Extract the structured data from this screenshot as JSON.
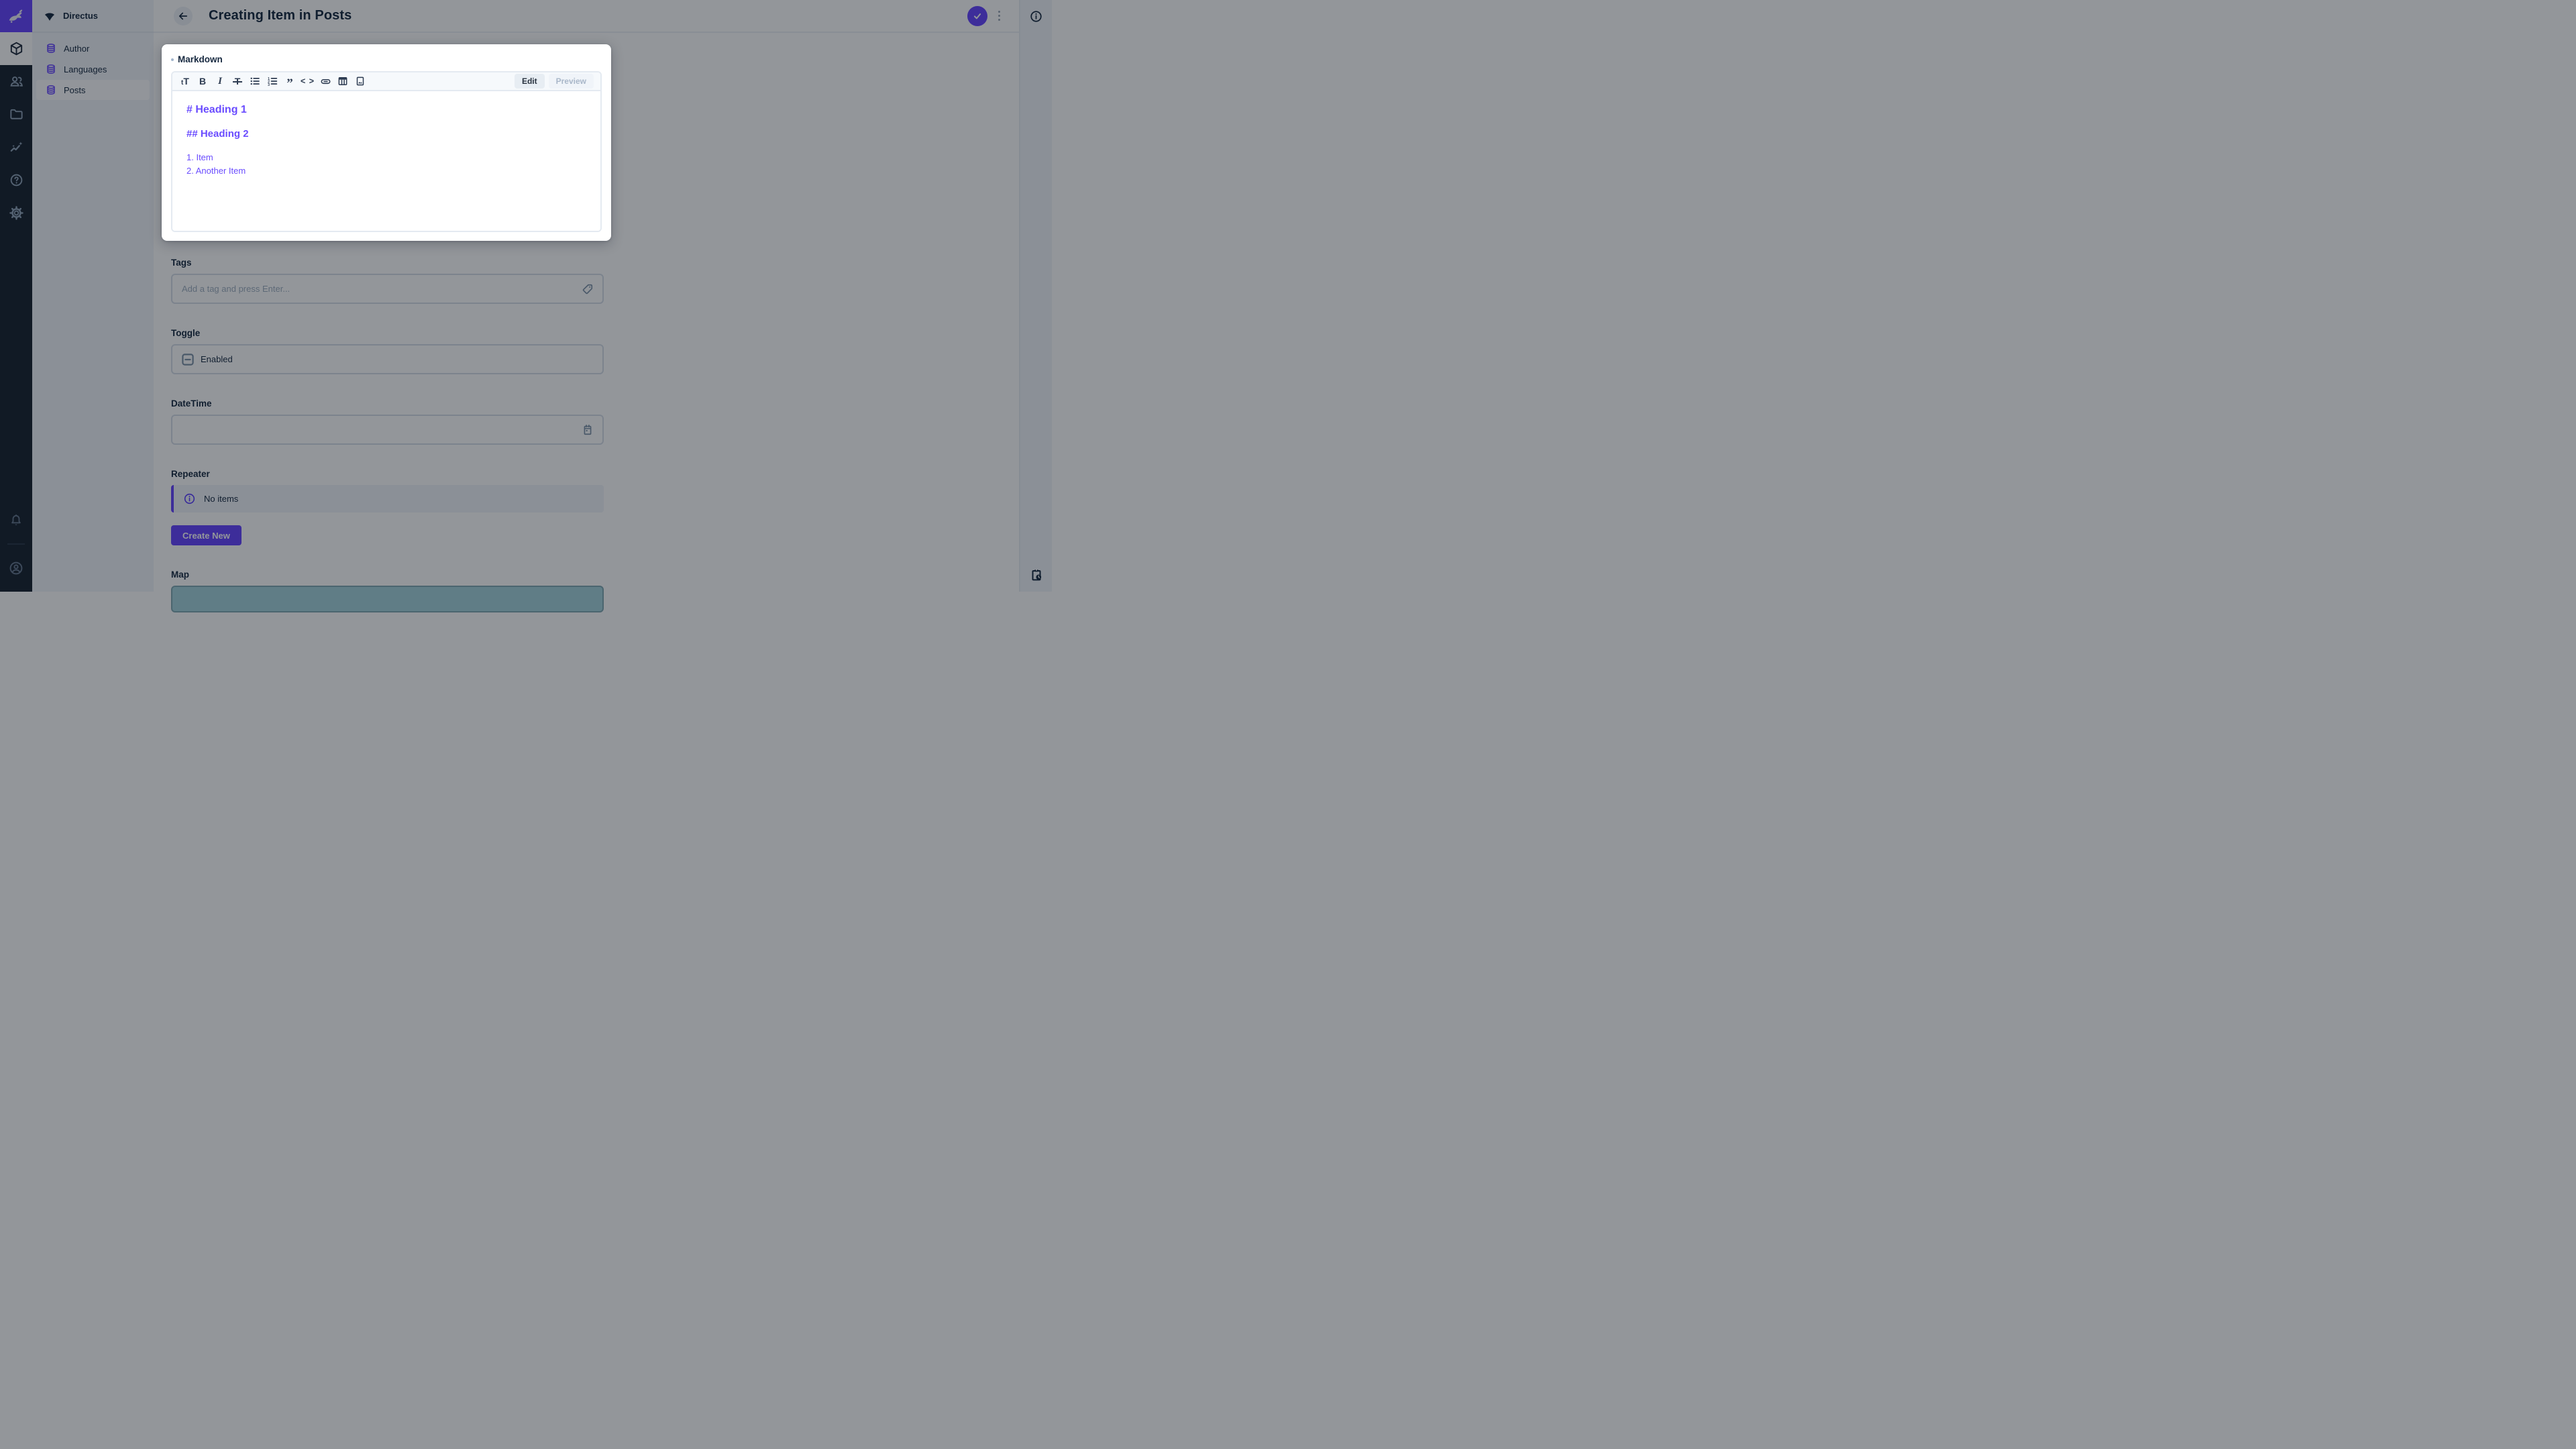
{
  "colors": {
    "accent": "#6644FF",
    "module_bar_bg": "#18222F",
    "sidebar_bg": "#F0F4F9",
    "text_dark": "#172940",
    "muted_icon": "#8FA2B8",
    "markdown_text": "#6A4CFF",
    "map_fill": "#A5D3DC"
  },
  "module_bar": {
    "logo_icon": "directus-rabbit-logo",
    "modules": [
      "content-module",
      "user-directory-module",
      "file-library-module",
      "insights-module",
      "help-module",
      "settings-module"
    ],
    "active_module": "content-module",
    "bottom_icons": [
      "notifications-bell",
      "account-avatar"
    ]
  },
  "sidebar": {
    "project_icon": "project-wedge-icon",
    "project_name": "Directus",
    "items": [
      {
        "label": "Author",
        "icon": "database-icon"
      },
      {
        "label": "Languages",
        "icon": "database-icon"
      },
      {
        "label": "Posts",
        "icon": "database-icon"
      }
    ],
    "active_item": "Posts"
  },
  "header": {
    "title": "Creating Item in Posts",
    "back_icon": "arrow-left-icon",
    "save_icon": "check-icon",
    "menu_icon": "more-vertical-icon"
  },
  "right_bar": {
    "top_icon": "info-icon",
    "bottom_icon": "clipboard-clock-icon"
  },
  "markdown_card": {
    "label": "Markdown",
    "toolbar_icons": [
      "heading-icon",
      "bold-icon",
      "italic-icon",
      "strikethrough-icon",
      "bullet-list-icon",
      "numbered-list-icon",
      "blockquote-icon",
      "code-icon",
      "link-icon",
      "table-icon",
      "image-icon"
    ],
    "glyphs": {
      "heading_small": "t",
      "heading_big": "T",
      "bold": "B",
      "italic": "I",
      "strikethrough": "T",
      "blockquote": "”",
      "code": "< >"
    },
    "tabs": {
      "edit": "Edit",
      "preview": "Preview"
    },
    "active_tab": "Edit",
    "content": {
      "line1": "# Heading 1",
      "line2": "## Heading 2",
      "line3": "1. Item",
      "line4": "2. Another Item"
    }
  },
  "fields": {
    "tags": {
      "label": "Tags",
      "value": "",
      "placeholder": "Add a tag and press Enter...",
      "icon": "tag-icon"
    },
    "toggle": {
      "label": "Toggle",
      "value": "Enabled",
      "icon": "checkbox-indeterminate-icon"
    },
    "datetime": {
      "label": "DateTime",
      "value": "",
      "icon": "calendar-icon"
    },
    "repeater": {
      "label": "Repeater",
      "empty_message": "No items",
      "empty_icon": "info-circle-icon",
      "button": "Create New"
    },
    "map": {
      "label": "Map"
    }
  }
}
